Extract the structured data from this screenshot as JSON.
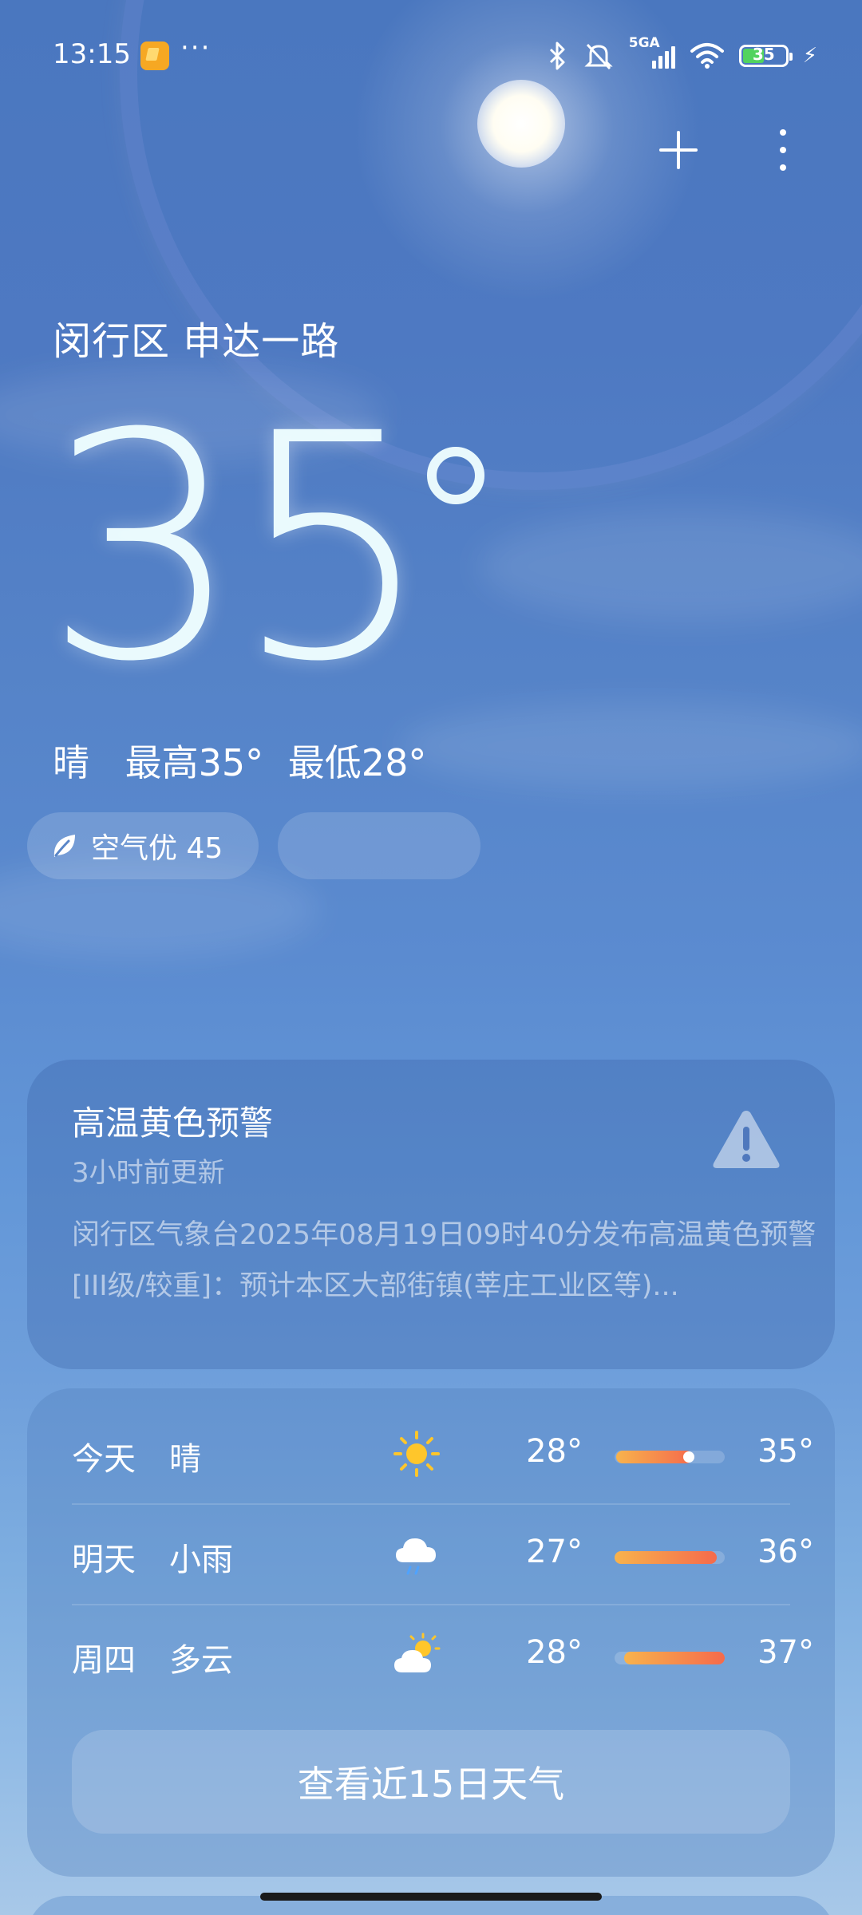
{
  "status_bar": {
    "time": "13:15",
    "more": "···",
    "signal_label": "5GA",
    "battery_level": "35",
    "battery_charging": true
  },
  "header": {
    "location": "闵行区 申达一路"
  },
  "current": {
    "temperature": "35",
    "condition": "晴",
    "high": "最高35°",
    "low": "最低28°",
    "air_quality": "空气优 45"
  },
  "alert": {
    "title": "高温黄色预警",
    "updated": "3小时前更新",
    "body": "闵行区气象台2025年08月19日09时40分发布高温黄色预警[III级/较重]：预计本区大部街镇(莘庄工业区等)..."
  },
  "forecast": {
    "rows": [
      {
        "day": "今天",
        "condition": "晴",
        "icon": "sun-icon",
        "low": "28°",
        "high": "35°"
      },
      {
        "day": "明天",
        "condition": "小雨",
        "icon": "rain-cloud-icon",
        "low": "27°",
        "high": "36°"
      },
      {
        "day": "周四",
        "condition": "多云",
        "icon": "partly-cloudy-icon",
        "low": "28°",
        "high": "37°"
      }
    ],
    "more_label": "查看近15日天气"
  },
  "colors": {
    "bar_start": "#f8b34d",
    "bar_end": "#f56a4b",
    "battery_green": "#52d35f"
  }
}
